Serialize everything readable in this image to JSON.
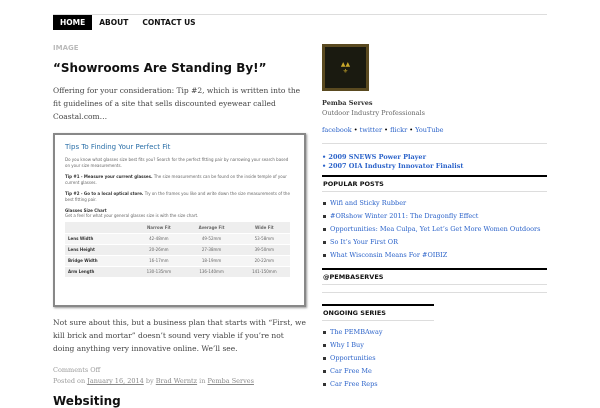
{
  "nav": [
    "HOME",
    "ABOUT",
    "CONTACT US"
  ],
  "post": {
    "category": "IMAGE",
    "title": "“Showrooms Are Standing By!”",
    "intro": "Offering for your consideration: Tip #2, which is written into the fit guidelines of a site that sells discounted eyewear called Coastal.com…",
    "image": {
      "title": "Tips To Finding Your Perfect Fit",
      "p1": "Do you know what glasses size best fits you? Search for the perfect fitting pair by narrowing your search based on your size measurements.",
      "tip1_bold": "Tip #1 - Measure your current glasses.",
      "tip1": " The size measurements can be found on the inside temple of your current glasses.",
      "tip2_bold": "Tip #2 - Go to a local optical store.",
      "tip2": " Try on the frames you like and write down the size measurements of the best fitting pair.",
      "chart_title": "Glasses Size Chart",
      "chart_sub": "Get a feel for what your general glasses size is with the size chart.",
      "headers": [
        "",
        "Narrow Fit",
        "Average Fit",
        "Wide Fit"
      ],
      "rows": [
        [
          "Lens Width",
          "42-48mm",
          "49-52mm",
          "53-58mm"
        ],
        [
          "Lens Height",
          "20-26mm",
          "27-38mm",
          "39-50mm"
        ],
        [
          "Bridge Width",
          "16-17mm",
          "18-19mm",
          "20-22mm"
        ],
        [
          "Arm Length",
          "130-135mm",
          "136-140mm",
          "141-150mm"
        ]
      ]
    },
    "body": "Not sure about this, but a business plan that starts with “First, we kill brick and mortar” doesn’t sound very viable if you’re not doing anything very innovative online. We’ll see.",
    "comments": "Comments Off",
    "posted_on": "Posted on",
    "date": "January 16, 2014",
    "by": "by",
    "author": "Brad Werntz",
    "in": "in",
    "category_link": "Pemba Serves"
  },
  "next_title": "Websiting",
  "sidebar": {
    "logo_text": "PEMBA SERVES",
    "name": "Pemba Serves",
    "tagline": "Outdoor Industry Professionals",
    "social": [
      "facebook",
      "twitter",
      "flickr",
      "YouTube"
    ],
    "sep": " • ",
    "awards": [
      "• 2009 SNEWS Power Player",
      "• 2007 OIA Industry Innovator Finalist"
    ],
    "popular_title": "POPULAR POSTS",
    "popular": [
      "Wifi and Sticky Rubber",
      "#ORshow Winter 2011: The Dragonfly Effect",
      "Opportunities: Mea Culpa, Yet Let’s Get More Women Outdoors",
      "So It’s Your First OR",
      "What Wisconsin Means For #OIBIZ"
    ],
    "twitter_title": "@PEMBASERVES",
    "series_title": "ONGOING SERIES",
    "series": [
      "The PEMBAway",
      "Why I Buy",
      "Opportunities",
      "Car Free Me",
      "Car Free Reps"
    ]
  }
}
